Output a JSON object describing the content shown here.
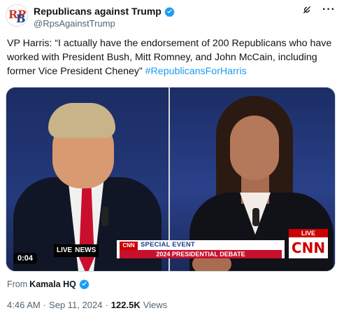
{
  "author": {
    "display_name": "Republicans against Trump",
    "handle": "@RpsAgainstTrump",
    "avatar_letters": {
      "top": "RP",
      "bottom": "B"
    },
    "verified": true
  },
  "tweet": {
    "text": "VP Harris: “I actually have the endorsement of 200 Republicans who have worked with President Bush, Mitt Romney, and John McCain, including former Vice President Cheney” ",
    "hashtag": "#RepublicansForHarris"
  },
  "media": {
    "type": "video",
    "duration": "0:04",
    "overlay": {
      "live_label": "LIVE",
      "network_label": "NEWS",
      "badge": "CNN",
      "event_label": "SPECIAL EVENT",
      "debate_label": "2024 PRESIDENTIAL DEBATE",
      "corner_live": "LIVE",
      "corner_logo": "CNN"
    }
  },
  "from": {
    "prefix": "From",
    "source": "Kamala HQ",
    "verified": true
  },
  "meta": {
    "time": "4:46 AM",
    "separator": "·",
    "date": "Sep 11, 2024",
    "views_count": "122.5K",
    "views_label": "Views"
  },
  "icons": {
    "verified": "verified-badge-icon",
    "grok": "grok-icon",
    "more": "more-icon"
  },
  "colors": {
    "accent": "#1d9bf0",
    "text_primary": "#0f1419",
    "text_secondary": "#536471",
    "cnn_red": "#cc0000"
  }
}
